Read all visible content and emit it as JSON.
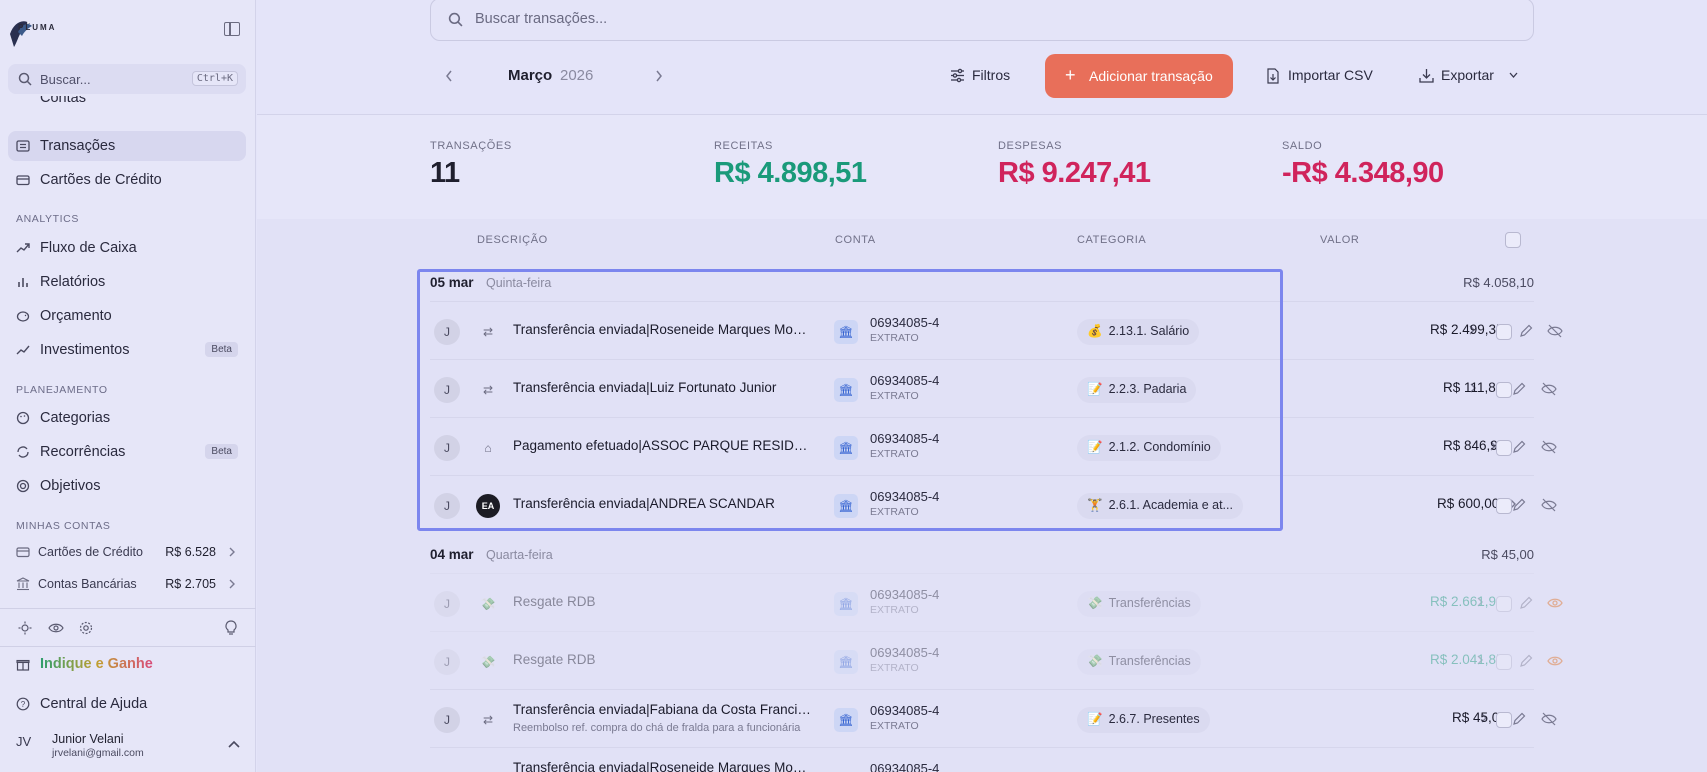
{
  "sidebar": {
    "logo_text": "PLUMA",
    "search_placeholder": "Buscar...",
    "search_shortcut": "Ctrl+K",
    "partial_item": "Contas",
    "items_top": [
      {
        "label": "Transações",
        "active": true,
        "icon": "list-icon"
      },
      {
        "label": "Cartões de Crédito",
        "icon": "credit-card-icon"
      }
    ],
    "section_analytics": "ANALYTICS",
    "analytics_items": [
      {
        "label": "Fluxo de Caixa",
        "icon": "trend-icon"
      },
      {
        "label": "Relatórios",
        "icon": "bar-chart-icon"
      },
      {
        "label": "Orçamento",
        "icon": "piggy-bank-icon"
      },
      {
        "label": "Investimentos",
        "icon": "trend-up-icon",
        "badge": "Beta"
      }
    ],
    "section_planning": "PLANEJAMENTO",
    "planning_items": [
      {
        "label": "Categorias",
        "icon": "palette-icon"
      },
      {
        "label": "Recorrências",
        "icon": "refresh-icon",
        "badge": "Beta"
      },
      {
        "label": "Objetivos",
        "icon": "target-icon"
      }
    ],
    "section_accounts": "MINHAS CONTAS",
    "accounts": [
      {
        "label": "Cartões de Crédito",
        "value": "R$ 6.528",
        "icon": "credit-card-icon"
      },
      {
        "label": "Contas Bancárias",
        "value": "R$ 2.705",
        "icon": "bank-icon"
      }
    ],
    "refer_label": "Indique e Ganhe",
    "help_label": "Central de Ajuda",
    "user": {
      "initials": "JV",
      "name": "Junior Velani",
      "email": "jrvelani@gmail.com"
    }
  },
  "toolbar": {
    "search_placeholder": "Buscar transações...",
    "month": "Março",
    "year": "2026",
    "filters_label": "Filtros",
    "add_label": "Adicionar transação",
    "import_label": "Importar CSV",
    "export_label": "Exportar"
  },
  "summary": {
    "transactions_title": "TRANSAÇÕES",
    "transactions_value": "11",
    "income_title": "RECEITAS",
    "income_value": "R$ 4.898,51",
    "expenses_title": "DESPESAS",
    "expenses_value": "R$ 9.247,41",
    "balance_title": "SALDO",
    "balance_value": "-R$ 4.348,90",
    "colors": {
      "income": "#1a9a7a",
      "expenses": "#d0245c",
      "balance": "#d0245c"
    }
  },
  "table": {
    "columns": [
      "DESCRIÇÃO",
      "CONTA",
      "CATEGORIA",
      "VALOR"
    ],
    "groups": [
      {
        "date": "05 mar",
        "weekday": "Quinta-feira",
        "total": "R$ 4.058,10",
        "rows": [
          {
            "avatar": "J",
            "icon": "transfer-icon",
            "icon_glyph": "⇄",
            "desc": "Transferência enviada|Roseneide Marques Monteiro",
            "account": "06934085-4",
            "source": "EXTRATO",
            "cat_emoji": "💰",
            "category": "2.13.1. Salário",
            "amount": "R$ 2.499,35"
          },
          {
            "avatar": "J",
            "icon": "transfer-icon",
            "icon_glyph": "⇄",
            "desc": "Transferência enviada|Luiz Fortunato Junior",
            "account": "06934085-4",
            "source": "EXTRATO",
            "cat_emoji": "📝",
            "category": "2.2.3. Padaria",
            "amount": "R$ 111,80"
          },
          {
            "avatar": "J",
            "icon": "home-icon",
            "icon_glyph": "⌂",
            "desc": "Pagamento efetuado|ASSOC PARQUE RESIDENCIAL",
            "account": "06934085-4",
            "source": "EXTRATO",
            "cat_emoji": "📝",
            "category": "2.1.2. Condomínio",
            "amount": "R$ 846,95"
          },
          {
            "avatar": "J",
            "icon": "ea-logo-icon",
            "icon_glyph": "EA",
            "desc": "Transferência enviada|ANDREA SCANDAR",
            "account": "06934085-4",
            "source": "EXTRATO",
            "cat_emoji": "🏋",
            "category": "2.6.1. Academia e at...",
            "amount": "R$ 600,00"
          }
        ]
      },
      {
        "date": "04 mar",
        "weekday": "Quarta-feira",
        "total": "R$ 45,00",
        "rows": [
          {
            "avatar": "J",
            "icon": "money-icon",
            "icon_glyph": "💸",
            "desc": "Resgate RDB",
            "account": "06934085-4",
            "source": "EXTRATO",
            "cat_emoji": "💸",
            "category": "Transferências",
            "amount": "R$ 2.661,90"
          },
          {
            "avatar": "J",
            "icon": "money-icon",
            "icon_glyph": "💸",
            "desc": "Resgate RDB",
            "account": "06934085-4",
            "source": "EXTRATO",
            "cat_emoji": "💸",
            "category": "Transferências",
            "amount": "R$ 2.041,85"
          },
          {
            "avatar": "J",
            "icon": "transfer-icon",
            "icon_glyph": "⇄",
            "desc": "Transferência enviada|Fabiana da Costa Francisco",
            "sub": "Reembolso ref. compra do chá de fralda para a funcionária",
            "account": "06934085-4",
            "source": "EXTRATO",
            "cat_emoji": "📝",
            "category": "2.6.7. Presentes",
            "amount": "R$ 45,00"
          },
          {
            "avatar": "J",
            "icon": "transfer-icon",
            "icon_glyph": "⇄",
            "desc": "Transferência enviada|Roseneide Marques Monteiro",
            "account": "06934085-4",
            "source": "",
            "cat_emoji": "",
            "category": "",
            "amount": ""
          }
        ]
      }
    ]
  }
}
